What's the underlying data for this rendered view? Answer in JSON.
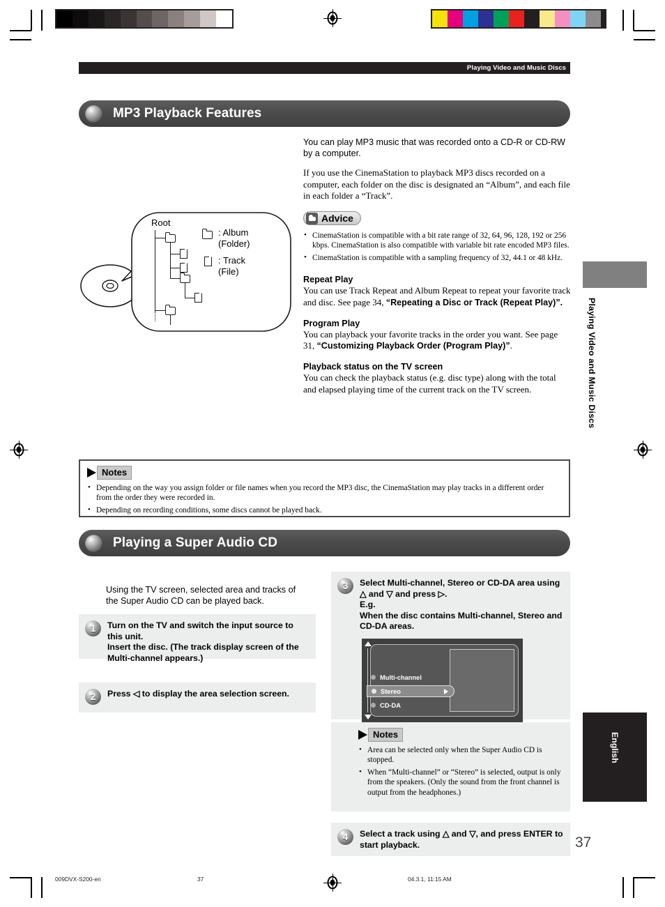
{
  "page": {
    "running_head": "Playing Video and Music Discs",
    "page_number": "37",
    "side_tab_vertical": "Playing Video and Music Discs",
    "language_tab": "English"
  },
  "footer": {
    "file": "009DVX-S200-en",
    "page": "37",
    "timestamp": "04.3.1, 11:15 AM"
  },
  "calibration": {
    "gray_swatches": [
      "#000000",
      "#0d0b0b",
      "#1a1717",
      "#2b2626",
      "#3b3434",
      "#554d4c",
      "#6d6565",
      "#8a817f",
      "#a69d9b",
      "#cfc7c4",
      "#ffffff"
    ],
    "color_swatches": [
      "#f5e10b",
      "#e6007e",
      "#00a0e3",
      "#2e3192",
      "#00a05a",
      "#e8221f",
      "#231f20",
      "#fae98a",
      "#f58fc2",
      "#7fd4f5",
      "#8c8c8c"
    ]
  },
  "section1": {
    "title": "MP3 Playback Features",
    "intro1": "You can play MP3 music that was recorded onto a CD-R or CD-RW by a computer.",
    "intro2": "If you use the CinemaStation to playback MP3 discs recorded on a computer, each folder on the disc is designated an “Album”, and each file in each folder a “Track”.",
    "advice_label": "Advice",
    "advice_items": [
      "CinemaStation is compatible with a bit rate range of 32, 64, 96, 128, 192 or 256 kbps. CinemaStation is also compatible with variable bit rate encoded MP3 files.",
      "CinemaStation is compatible with a sampling frequency of 32, 44.1 or 48 kHz."
    ],
    "topics": [
      {
        "heading": "Repeat Play",
        "body_plain": "You can use Track Repeat and Album Repeat to repeat your favorite track and disc. See page 34, ",
        "body_bold": "“Repeating a Disc or Track (Repeat Play)”.",
        "body_tail": ""
      },
      {
        "heading": "Program Play",
        "body_plain": "You can playback your favorite tracks in the order you want. See page 31, ",
        "body_bold": "“Customizing Playback Order (Program Play)”",
        "body_tail": "."
      },
      {
        "heading": "Playback status on the TV screen",
        "body_plain": "You can check the playback status (e.g. disc type) along with the total and elapsed playing time of the current track on the TV screen.",
        "body_bold": "",
        "body_tail": ""
      }
    ],
    "diagram": {
      "root_label": "Root",
      "legend_album": ": Album (Folder)",
      "legend_album_line1": ": Album",
      "legend_album_line2": "(Folder)",
      "legend_track_line1": ": Track",
      "legend_track_line2": "(File)"
    },
    "notes_label": "Notes",
    "notes": [
      "Depending on the way you assign folder or file names when you record the MP3 disc, the CinemaStation may play tracks in a different order from the order they were recorded in.",
      "Depending on recording conditions, some discs cannot be played back."
    ]
  },
  "section2": {
    "title": "Playing a Super Audio CD",
    "intro": "Using the TV screen, selected area and tracks of the Super Audio CD can be played back.",
    "steps": [
      {
        "num": "1",
        "text": "Turn on the TV and switch the input source to this unit.\nInsert the disc. (The track display screen of the Multi-channel appears.)"
      },
      {
        "num": "2",
        "text": "Press ◁ to display the area selection screen."
      },
      {
        "num": "3",
        "text": "Select Multi-channel, Stereo or CD-DA area using △ and ▽ and press ▷.\nE.g.\nWhen the disc contains Multi-channel, Stereo and CD-DA areas."
      },
      {
        "num": "4",
        "text": "Select a track using △ and ▽, and press ENTER to start playback."
      }
    ],
    "tv_screen": {
      "items": [
        "Multi-channel",
        "Stereo",
        "CD-DA"
      ],
      "selected": "Stereo"
    },
    "notes_label": "Notes",
    "notes": [
      "Area can be selected only when the Super Audio CD is stopped.",
      "When “Multi-channel” or “Stereo” is selected, output is only from the speakers. (Only the sound from the front channel is output from the headphones.)"
    ]
  }
}
